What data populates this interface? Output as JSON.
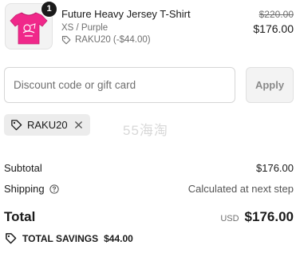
{
  "line_item": {
    "quantity": "1",
    "name": "Future Heavy Jersey T-Shirt",
    "variant": "XS / Purple",
    "discount": "RAKU20 (-$44.00)",
    "original_price": "$220.00",
    "price": "$176.00",
    "thumbnail_color": "#f0288a"
  },
  "discount_form": {
    "placeholder": "Discount code or gift card",
    "value": "",
    "apply_label": "Apply"
  },
  "applied_code": {
    "code": "RAKU20"
  },
  "watermark": "55海淘",
  "summary": {
    "subtotal_label": "Subtotal",
    "subtotal_value": "$176.00",
    "shipping_label": "Shipping",
    "shipping_value": "Calculated at next step",
    "total_label": "Total",
    "currency": "USD",
    "total_value": "$176.00",
    "savings_label": "TOTAL SAVINGS",
    "savings_value": "$44.00"
  },
  "icons": {
    "tag": "tag-icon",
    "remove": "close-icon",
    "help": "question-circle-icon"
  }
}
